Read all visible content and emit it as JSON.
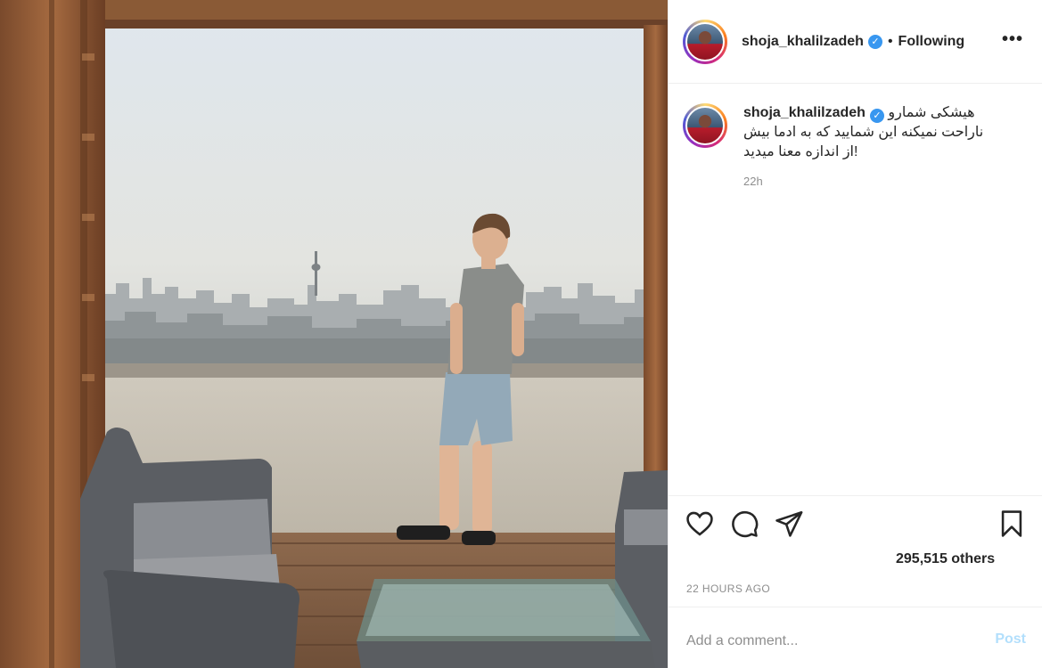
{
  "post": {
    "username": "shoja_khalilzadeh",
    "verified_icon": "verified-badge-icon",
    "dot_separator": "•",
    "follow_status": "Following",
    "more_label": "•••"
  },
  "caption": {
    "username": "shoja_khalilzadeh",
    "line1": "هیشکی شمارو",
    "line2": "ناراحت نمیکنه این شمایید که به ادما بیش",
    "line3": "!از اندازه معنا میدید",
    "time": "22h"
  },
  "actions": {
    "like_icon": "heart-icon",
    "comment_icon": "comment-icon",
    "share_icon": "share-icon",
    "save_icon": "bookmark-icon"
  },
  "likes_text": "295,515 others",
  "timestamp": "22 HOURS AGO",
  "comment": {
    "placeholder": "Add a comment...",
    "post_label": "Post"
  },
  "colors": {
    "verified": "#3897f0",
    "post_button_disabled": "#b2dffc",
    "secondary_text": "#8e8e8e"
  }
}
